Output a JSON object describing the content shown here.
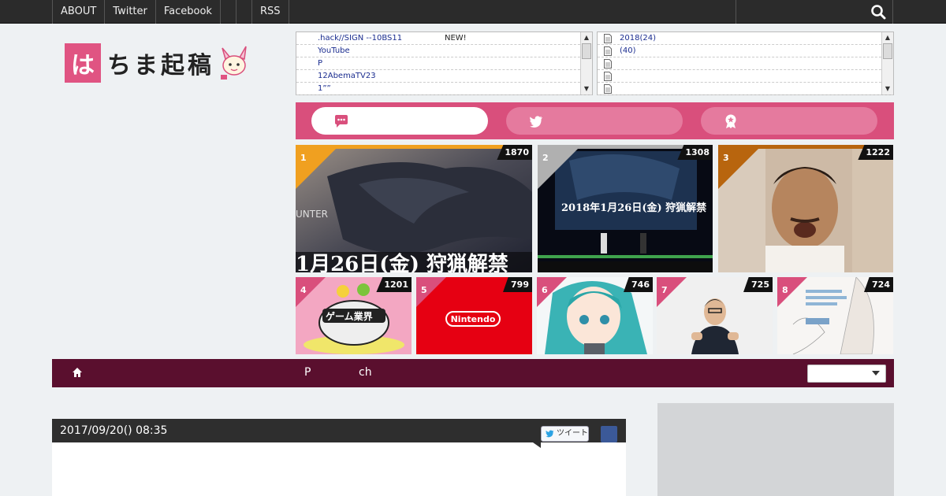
{
  "topnav": {
    "items": [
      "ABOUT",
      "Twitter",
      "Facebook",
      "",
      "",
      "RSS"
    ]
  },
  "logo": {
    "badge": "は",
    "text": "ちま起稿"
  },
  "news_panel": {
    "rows": [
      {
        "text": ".hack//SIGN --10BS11",
        "badge": "NEW!"
      },
      {
        "text": "YouTube",
        "badge": ""
      },
      {
        "text": "P",
        "badge": ""
      },
      {
        "text": "12AbemaTV23",
        "badge": ""
      },
      {
        "text": "1””",
        "badge": ""
      }
    ]
  },
  "archive_panel": {
    "rows": [
      "2018(24)",
      "(40)",
      "",
      "",
      ""
    ]
  },
  "tabs": [
    {
      "icon": "speech-bubble-icon",
      "active": true
    },
    {
      "icon": "twitter-bird-icon",
      "active": false
    },
    {
      "icon": "award-ribbon-icon",
      "active": false
    }
  ],
  "ranking": [
    {
      "rank": "1",
      "count": "1870",
      "corner": "#f0a020"
    },
    {
      "rank": "2",
      "count": "1308",
      "corner": "#b0b0b0"
    },
    {
      "rank": "3",
      "count": "1222",
      "corner": "#b8650e"
    },
    {
      "rank": "4",
      "count": "1201",
      "corner": "#d94f7c"
    },
    {
      "rank": "5",
      "count": "799",
      "corner": "#d94f7c"
    },
    {
      "rank": "6",
      "count": "746",
      "corner": "#d94f7c"
    },
    {
      "rank": "7",
      "count": "725",
      "corner": "#d94f7c"
    },
    {
      "rank": "8",
      "count": "724",
      "corner": "#d94f7c"
    }
  ],
  "navbar": {
    "items": [
      "P",
      "ch"
    ]
  },
  "article": {
    "date": "2017/09/20() 08:35",
    "tweet_label": "ツイート"
  },
  "colors": {
    "accent_pink": "#d94f7c",
    "nav_maroon": "#5a0f2e",
    "topbar": "#2b2b2b"
  }
}
